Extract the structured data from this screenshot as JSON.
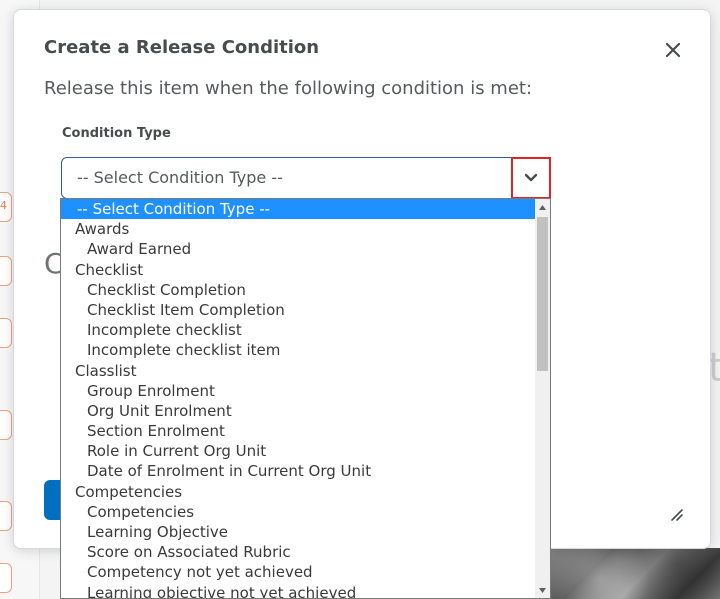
{
  "dialog": {
    "title": "Create a Release Condition",
    "instruction": "Release this item when the following condition is met:",
    "condition_type_label": "Condition Type",
    "select_value": "-- Select Condition Type --"
  },
  "background": {
    "tab_number": "4",
    "right_letter": "t",
    "covered_letter": "C"
  },
  "dropdown": {
    "items": [
      {
        "label": "-- Select Condition Type --",
        "kind": "selected"
      },
      {
        "label": "Awards",
        "kind": "group"
      },
      {
        "label": "Award Earned",
        "kind": "option"
      },
      {
        "label": "Checklist",
        "kind": "group"
      },
      {
        "label": "Checklist Completion",
        "kind": "option"
      },
      {
        "label": "Checklist Item Completion",
        "kind": "option"
      },
      {
        "label": "Incomplete checklist",
        "kind": "option"
      },
      {
        "label": "Incomplete checklist item",
        "kind": "option"
      },
      {
        "label": "Classlist",
        "kind": "group"
      },
      {
        "label": "Group Enrolment",
        "kind": "option"
      },
      {
        "label": "Org Unit Enrolment",
        "kind": "option"
      },
      {
        "label": "Section Enrolment",
        "kind": "option"
      },
      {
        "label": "Role in Current Org Unit",
        "kind": "option"
      },
      {
        "label": "Date of Enrolment in Current Org Unit",
        "kind": "option"
      },
      {
        "label": "Competencies",
        "kind": "group"
      },
      {
        "label": "Competencies",
        "kind": "option"
      },
      {
        "label": "Learning Objective",
        "kind": "option"
      },
      {
        "label": "Score on Associated Rubric",
        "kind": "option"
      },
      {
        "label": "Competency not yet achieved",
        "kind": "option"
      },
      {
        "label": "Learning objective not yet achieved",
        "kind": "option"
      }
    ]
  },
  "colors": {
    "accent": "#006fbf",
    "selected_bg": "#1e90ff",
    "highlight_border": "#e02424"
  }
}
